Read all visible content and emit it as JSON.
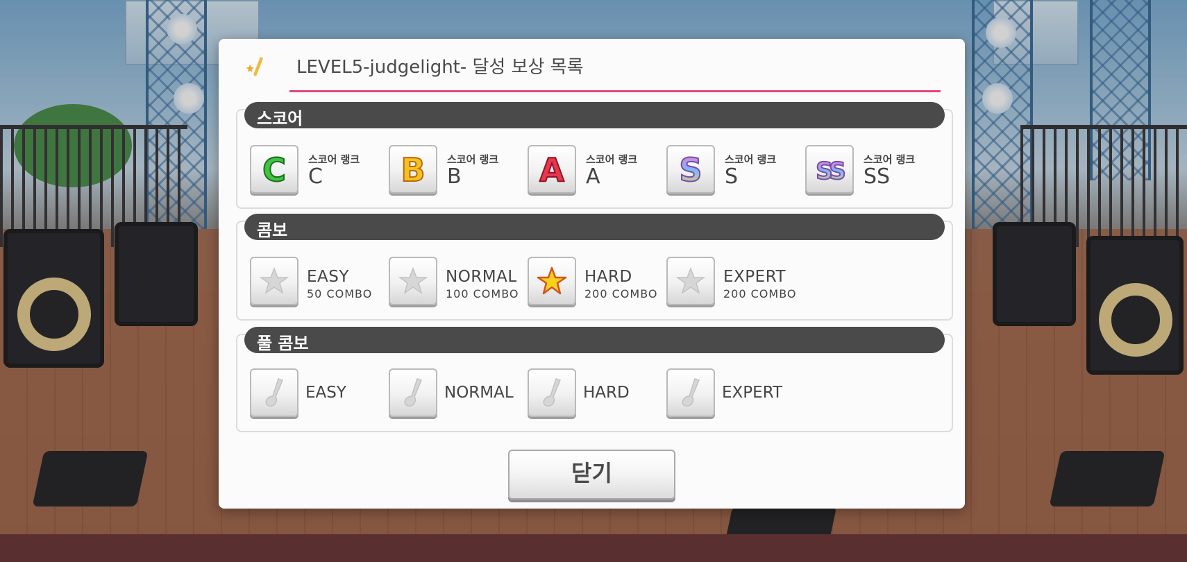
{
  "dialog": {
    "title": "LEVEL5-judgelight- 달성 보상 목록",
    "accent_color": "#e5457c",
    "close_label": "닫기"
  },
  "score_section": {
    "title": "스코어",
    "items": [
      {
        "caption": "스코어 랭크",
        "rank": "C",
        "icon": "rank-c-icon"
      },
      {
        "caption": "스코어 랭크",
        "rank": "B",
        "icon": "rank-b-icon"
      },
      {
        "caption": "스코어 랭크",
        "rank": "A",
        "icon": "rank-a-icon"
      },
      {
        "caption": "스코어 랭크",
        "rank": "S",
        "icon": "rank-s-icon"
      },
      {
        "caption": "스코어 랭크",
        "rank": "SS",
        "icon": "rank-ss-icon"
      }
    ]
  },
  "combo_section": {
    "title": "콤보",
    "items": [
      {
        "difficulty": "EASY",
        "count": "50 COMBO",
        "achieved": false
      },
      {
        "difficulty": "NORMAL",
        "count": "100 COMBO",
        "achieved": false
      },
      {
        "difficulty": "HARD",
        "count": "200 COMBO",
        "achieved": true
      },
      {
        "difficulty": "EXPERT",
        "count": "200 COMBO",
        "achieved": false
      }
    ]
  },
  "full_combo_section": {
    "title": "풀 콤보",
    "items": [
      {
        "difficulty": "EASY",
        "achieved": false
      },
      {
        "difficulty": "NORMAL",
        "achieved": false
      },
      {
        "difficulty": "HARD",
        "achieved": false
      },
      {
        "difficulty": "EXPERT",
        "achieved": false
      }
    ]
  }
}
